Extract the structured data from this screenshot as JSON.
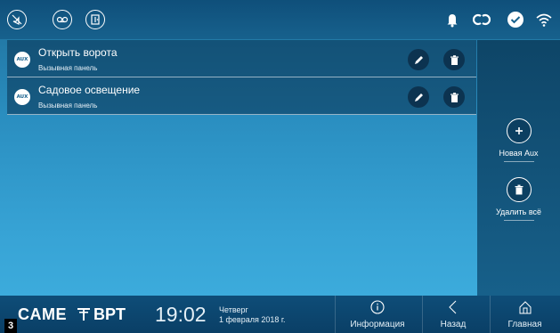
{
  "topbar": {
    "left_icons": [
      "no-sound-icon",
      "voicemail-icon",
      "door-status-icon"
    ],
    "status_icons": [
      "bell-icon",
      "link-icon",
      "check-icon",
      "wifi-icon"
    ]
  },
  "list": {
    "badge_text": "AUX",
    "items": [
      {
        "title": "Открыть ворота",
        "subtitle": "Вызывная панель"
      },
      {
        "title": "Садовое освещение",
        "subtitle": "Вызывная панель"
      }
    ]
  },
  "side": {
    "add_label": "Новая Aux",
    "delete_all_label": "Удалить всё"
  },
  "bottom": {
    "brand_came": "CAME",
    "brand_bpt": "BPT",
    "page_number": "3",
    "time": "19:02",
    "day": "Четверг",
    "date": "1 февраля 2018 г.",
    "nav": {
      "info": "Информация",
      "back": "Назад",
      "home": "Главная"
    }
  },
  "colors": {
    "accent": "#17618d",
    "dark": "#0c3350"
  }
}
